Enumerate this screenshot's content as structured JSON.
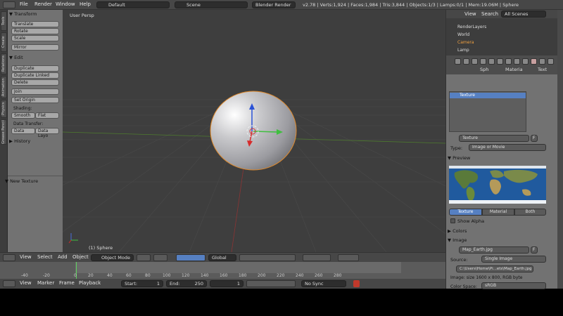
{
  "topbar": {
    "menus": [
      "File",
      "Render",
      "Window",
      "Help"
    ],
    "layout": "Default",
    "scene": "Scene",
    "engine": "Blender Render",
    "stats": "v2.78 | Verts:1,924 | Faces:1,984 | Tris:3,844 | Objects:1/3 | Lamps:0/1 | Mem:19.06M | Sphere"
  },
  "tabs": [
    "Tools",
    "Create",
    "Relations",
    "Animation",
    "Physics",
    "Grease Pencil"
  ],
  "tool": {
    "transform": "▼ Transform",
    "translate": "Translate",
    "rotate": "Rotate",
    "scale": "Scale",
    "mirror": "Mirror",
    "edit": "▼ Edit",
    "duplicate": "Duplicate",
    "duplicate_linked": "Duplicate Linked",
    "delete": "Delete",
    "join": "Join",
    "set_origin": "Set Origin",
    "shading": "Shading:",
    "smooth": "Smooth",
    "flat": "Flat",
    "data_transfer": "Data Transfer:",
    "data": "Data",
    "data_layo": "Data Layo",
    "history": "▶ History",
    "new_texture": "▼ New Texture"
  },
  "viewport": {
    "persp": "User Persp",
    "object": "(1) Sphere"
  },
  "vpbar": {
    "view": "View",
    "select": "Select",
    "add": "Add",
    "object": "Object",
    "mode": "Object Mode",
    "orientation": "Global"
  },
  "timeline": {
    "ticks": [
      "-40",
      "-20",
      "0",
      "20",
      "40",
      "60",
      "80",
      "100",
      "120",
      "140",
      "160",
      "180",
      "200",
      "220",
      "240",
      "260",
      "280"
    ]
  },
  "tlbar": {
    "view": "View",
    "marker": "Marker",
    "frame": "Frame",
    "playback": "Playback",
    "start_label": "Start:",
    "start": "1",
    "end_label": "End:",
    "end": "250",
    "current": "1",
    "sync": "No Sync"
  },
  "outliner": {
    "view": "View",
    "search": "Search",
    "scenes": "All Scenes",
    "items": [
      "RenderLayers",
      "World",
      "Camera",
      "Lamp"
    ]
  },
  "props": {
    "crumb1": "Sph",
    "crumb2": "Materia",
    "crumb3": "Text",
    "slot": "Texture",
    "texture_name": "Texture",
    "f_label": "F",
    "type_label": "Type:",
    "type_value": "Image or Movie",
    "preview": "▼ Preview",
    "tab_texture": "Texture",
    "tab_material": "Material",
    "tab_both": "Both",
    "show_alpha": "Show Alpha",
    "colors": "▶ Colors",
    "image": "▼ Image",
    "image_name": "Map_Earth.jpg",
    "source_label": "Source:",
    "source_value": "Single Image",
    "filepath": "C:\\Users\\Home\\Pi...ets\\Map_Earth.jpg",
    "image_info": "Image: size 1600 x 800, RGB byte",
    "color_space_label": "Color Space:",
    "color_space": "sRGB"
  }
}
